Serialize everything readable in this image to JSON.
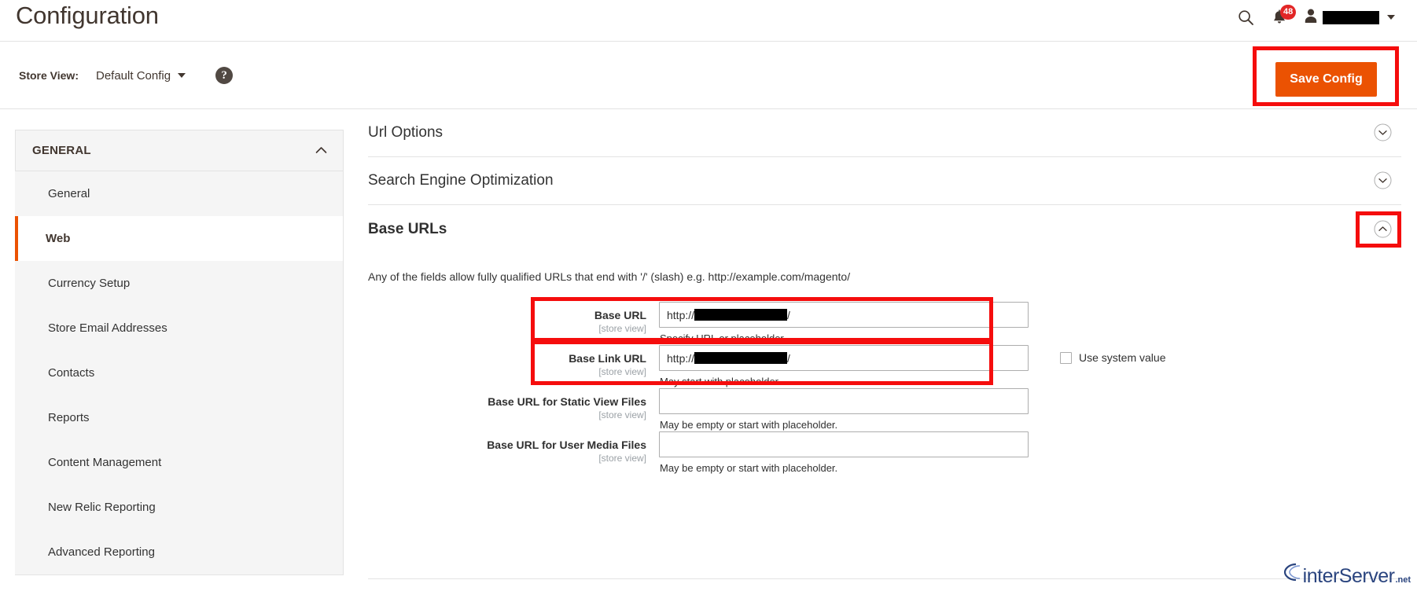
{
  "header": {
    "title": "Configuration",
    "search_icon": "search-icon",
    "notifications_icon": "bell-icon",
    "notifications_count": "48",
    "user_icon": "user-icon",
    "user_name_redacted": "",
    "user_menu_caret": "chevron-down-icon"
  },
  "toolbar": {
    "store_view_label": "Store View:",
    "store_view_value": "Default Config",
    "help_icon_glyph": "?",
    "save_label": "Save Config",
    "accent_orange": "#eb5202",
    "highlight_red": "#f50d0d"
  },
  "sidebar": {
    "group_title": "GENERAL",
    "group_collapse_icon": "chevron-up-icon",
    "items": [
      {
        "label": "General",
        "active": false
      },
      {
        "label": "Web",
        "active": true
      },
      {
        "label": "Currency Setup",
        "active": false
      },
      {
        "label": "Store Email Addresses",
        "active": false
      },
      {
        "label": "Contacts",
        "active": false
      },
      {
        "label": "Reports",
        "active": false
      },
      {
        "label": "Content Management",
        "active": false
      },
      {
        "label": "New Relic Reporting",
        "active": false
      },
      {
        "label": "Advanced Reporting",
        "active": false
      }
    ]
  },
  "content": {
    "sections": [
      {
        "title": "Url Options",
        "expanded": false,
        "icon": "chevron-down-circle-icon"
      },
      {
        "title": "Search Engine Optimization",
        "expanded": false,
        "icon": "chevron-down-circle-icon"
      },
      {
        "title": "Base URLs",
        "expanded": true,
        "icon": "chevron-up-circle-icon"
      }
    ],
    "base_urls": {
      "note": "Any of the fields allow fully qualified URLs that end with '/' (slash) e.g. http://example.com/magento/",
      "scope_tag": "[store view]",
      "fields": [
        {
          "label": "Base URL",
          "scope": "[store view]",
          "value_prefix": "http://",
          "value_redacted": true,
          "value_suffix": "/",
          "value": "",
          "hint": "Specify URL or placeholder.",
          "has_system_checkbox": false,
          "system_checkbox_label": "",
          "highlighted": true
        },
        {
          "label": "Base Link URL",
          "scope": "[store view]",
          "value_prefix": "http://",
          "value_redacted": true,
          "value_suffix": "/",
          "value": "",
          "hint": "May start with placeholder.",
          "has_system_checkbox": true,
          "system_checkbox_label": "Use system value",
          "system_checkbox_checked": false,
          "highlighted": true
        },
        {
          "label": "Base URL for Static View Files",
          "scope": "[store view]",
          "value_prefix": "",
          "value_redacted": false,
          "value_suffix": "",
          "value": "",
          "hint": "May be empty or start with placeholder.",
          "has_system_checkbox": false,
          "system_checkbox_label": "",
          "highlighted": false
        },
        {
          "label": "Base URL for User Media Files",
          "scope": "[store view]",
          "value_prefix": "",
          "value_redacted": false,
          "value_suffix": "",
          "value": "",
          "hint": "May be empty or start with placeholder.",
          "has_system_checkbox": false,
          "system_checkbox_label": "",
          "highlighted": false
        }
      ]
    }
  },
  "watermark": {
    "name": "interServer",
    "suffix": ".net"
  }
}
